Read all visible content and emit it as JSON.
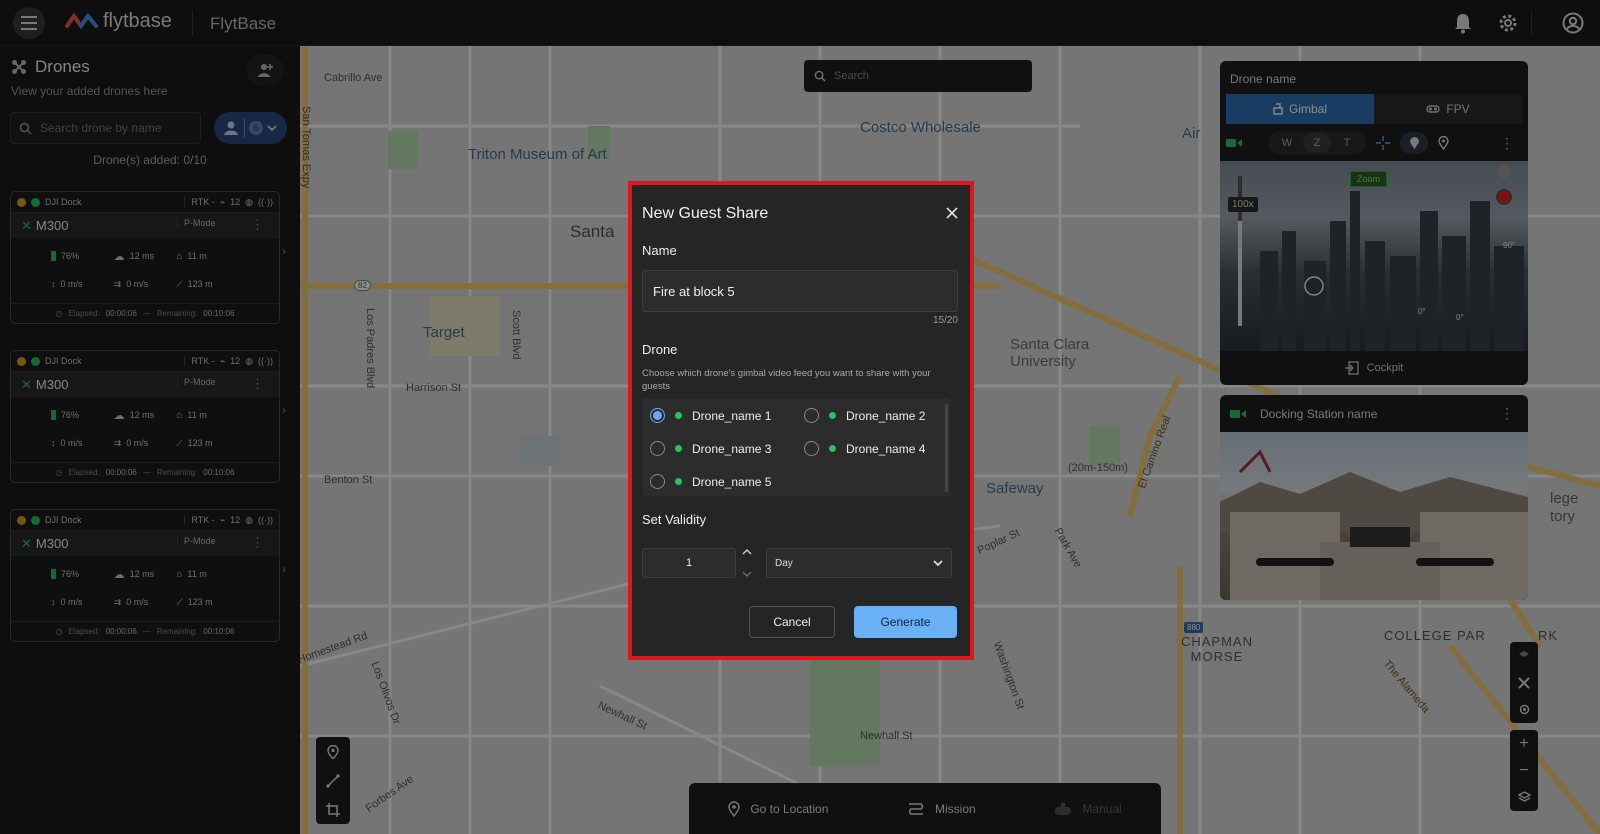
{
  "app": {
    "logo_text": "flytbase",
    "title": "FlytBase"
  },
  "topbar_icons": [
    "menu-icon",
    "bell-icon",
    "gear-icon",
    "user-icon"
  ],
  "sidebar": {
    "title": "Drones",
    "subtitle": "View your added drones here",
    "search_placeholder": "Search drone by name",
    "filter_badge": "6",
    "count_text": "Drone(s) added: 0/10",
    "cards": [
      {
        "dock": "DJI Dock",
        "rtk": "RTK -",
        "signal": "12",
        "model": "M300",
        "mode": "P-Mode",
        "battery": "76%",
        "wind": "12 ms",
        "altitude": "11 m",
        "vspeed": "0 m/s",
        "hspeed": "0 m/s",
        "distance": "123 m",
        "elapsed_label": "Elapsed:",
        "elapsed": "00:00:06",
        "remaining_label": "Remaining:",
        "remaining": "00:10:06"
      },
      {
        "dock": "DJI Dock",
        "rtk": "RTK -",
        "signal": "12",
        "model": "M300",
        "mode": "P-Mode",
        "battery": "76%",
        "wind": "12 ms",
        "altitude": "11 m",
        "vspeed": "0 m/s",
        "hspeed": "0 m/s",
        "distance": "123 m",
        "elapsed_label": "Elapsed:",
        "elapsed": "00:00:06",
        "remaining_label": "Remaining:",
        "remaining": "00:10:06"
      },
      {
        "dock": "DJI Dock",
        "rtk": "RTK -",
        "signal": "12",
        "model": "M300",
        "mode": "P-Mode",
        "battery": "76%",
        "wind": "12 ms",
        "altitude": "11 m",
        "vspeed": "0 m/s",
        "hspeed": "0 m/s",
        "distance": "123 m",
        "elapsed_label": "Elapsed:",
        "elapsed": "00:00:06",
        "remaining_label": "Remaining:",
        "remaining": "00:10:06"
      }
    ]
  },
  "map": {
    "search_placeholder": "Search",
    "labels": {
      "cabrillo": "Cabrillo Ave",
      "san_tomas": "San Tomas Expy",
      "triton": "Triton Museum of Art",
      "costco": "Costco Wholesale",
      "air": "Air",
      "santa": "Santa",
      "target": "Target",
      "los_padres": "Los Padres Blvd",
      "scott": "Scott Blvd",
      "harrison": "Harrison St",
      "benton": "Benton St",
      "homestead": "Homestead Rd",
      "santa_clara_u": "Santa Clara University",
      "el_camino": "El Camino Real",
      "safeway": "Safeway",
      "poplar": "Poplar St",
      "park": "Park Ave",
      "twenty": "(20m-150m)",
      "chapman": "CHAPMAN MORSE",
      "college_park": "COLLEGE PAR",
      "rk": "RK",
      "alameda": "The Alameda",
      "washington": "Washington St",
      "newhall": "Newhall St",
      "newhall2": "Newhall St",
      "los_olivos": "Los Olivos Dr",
      "forbes": "Forbes Ave",
      "lege": "lege",
      "tory": "tory",
      "hwy": "880",
      "r82": "82"
    }
  },
  "camera_panel": {
    "title": "Drone name",
    "tabs": [
      "Gimbal",
      "FPV"
    ],
    "wzt": [
      "W",
      "Z",
      "T"
    ],
    "zoom_level": "100x",
    "zoom_chip": "Zoom",
    "angle_top": "90°",
    "angle_a": "0°",
    "angle_b": "0°",
    "cockpit_label": "Cockpit"
  },
  "dock_panel": {
    "title": "Docking Station name"
  },
  "bottom_bar": {
    "go_to_location": "Go to Location",
    "mission": "Mission",
    "manual": "Manual"
  },
  "modal": {
    "title": "New Guest Share",
    "name_label": "Name",
    "name_value": "Fire at block 5",
    "name_counter": "15/20",
    "drone_label": "Drone",
    "drone_hint": "Choose which drone's gimbal video feed you want to share with your guests",
    "drones": [
      {
        "name": "Drone_name 1",
        "selected": true
      },
      {
        "name": "Drone_name 2",
        "selected": false
      },
      {
        "name": "Drone_name 3",
        "selected": false
      },
      {
        "name": "Drone_name 4",
        "selected": false
      },
      {
        "name": "Drone_name 5",
        "selected": false
      }
    ],
    "validity_label": "Set Validity",
    "validity_value": "1",
    "validity_unit": "Day",
    "cancel_label": "Cancel",
    "generate_label": "Generate"
  },
  "colors": {
    "accent": "#6ab0f5",
    "highlight_border": "#e0161f",
    "status_green": "#22c55e",
    "brand_blue": "#2f6fb3"
  }
}
